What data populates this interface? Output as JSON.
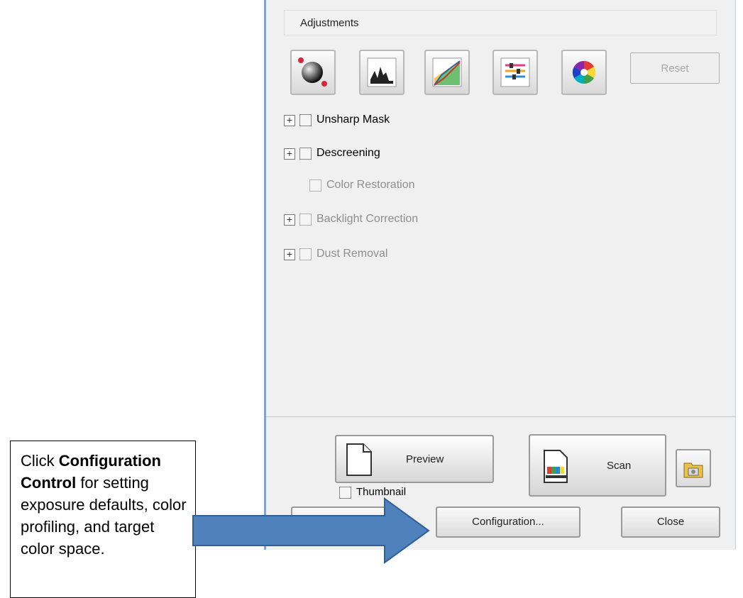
{
  "dialog": {
    "adjustments_label": "Adjustments",
    "reset_label": "Reset",
    "tools": [
      {
        "icon": "auto-exposure-icon"
      },
      {
        "icon": "histogram-icon"
      },
      {
        "icon": "tone-curve-icon"
      },
      {
        "icon": "image-adjustment-icon"
      },
      {
        "icon": "color-palette-icon"
      }
    ],
    "options": [
      {
        "label": "Unsharp Mask",
        "expandable": true,
        "enabled": true,
        "checked": false
      },
      {
        "label": "Descreening",
        "expandable": true,
        "enabled": true,
        "checked": false
      },
      {
        "label": "Color Restoration",
        "expandable": false,
        "enabled": false,
        "checked": false
      },
      {
        "label": "Backlight Correction",
        "expandable": true,
        "enabled": false,
        "checked": false
      },
      {
        "label": "Dust Removal",
        "expandable": true,
        "enabled": false,
        "checked": false
      }
    ],
    "preview_label": "Preview",
    "scan_label": "Scan",
    "thumbnail_label": "Thumbnail",
    "configuration_label": "Configuration...",
    "close_label": "Close"
  },
  "callout": {
    "text_1": "Click ",
    "bold_1": "Configuration Control",
    "text_2": " for setting exposure defaults, color profiling, and target color space."
  },
  "colors": {
    "arrow_fill": "#4f81bd",
    "arrow_stroke": "#2f5f94",
    "panel_bg": "#f0f0f0"
  }
}
